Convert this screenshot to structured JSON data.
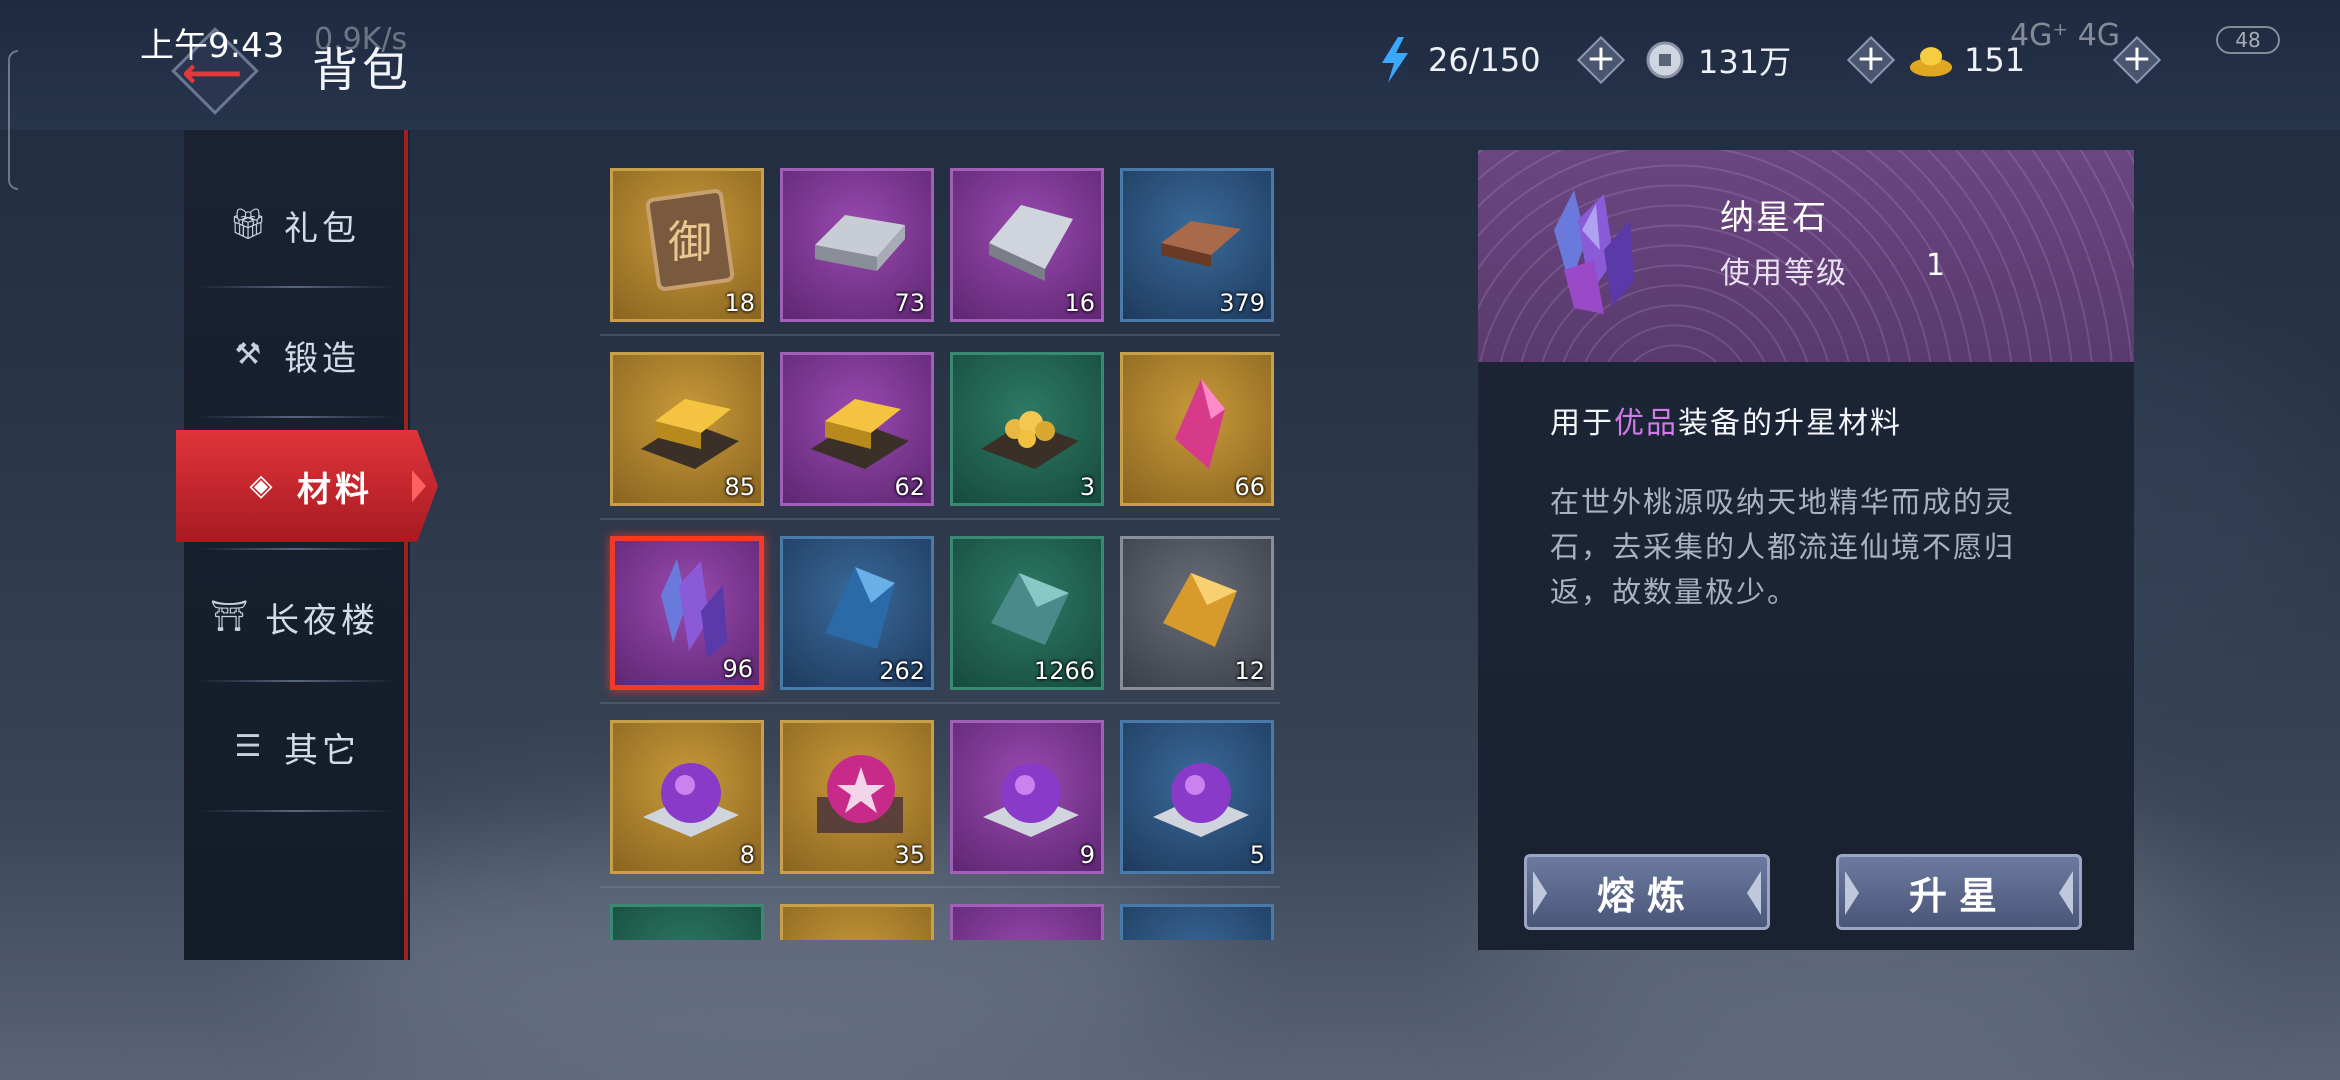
{
  "status_bar": {
    "time": "上午9:43",
    "speed": "0.9K/s",
    "network": "4G⁺ 4G",
    "battery": "48"
  },
  "header": {
    "title": "背包"
  },
  "resources": {
    "stamina": "26/150",
    "coins": "131万",
    "ingots": "151"
  },
  "tabs": [
    {
      "label": "礼包"
    },
    {
      "label": "锻造"
    },
    {
      "label": "材料"
    },
    {
      "label": "长夜楼"
    },
    {
      "label": "其它"
    }
  ],
  "active_tab": "材料",
  "items": [
    {
      "name": "御令",
      "qty": "18",
      "rarity": "gold"
    },
    {
      "name": "银锭",
      "qty": "73",
      "rarity": "purple"
    },
    {
      "name": "玄铁",
      "qty": "16",
      "rarity": "purple"
    },
    {
      "name": "铜锭",
      "qty": "379",
      "rarity": "blue"
    },
    {
      "name": "金锭",
      "qty": "85",
      "rarity": "gold"
    },
    {
      "name": "金锭",
      "qty": "62",
      "rarity": "purple"
    },
    {
      "name": "碎金",
      "qty": "3",
      "rarity": "green"
    },
    {
      "name": "红晶石",
      "qty": "66",
      "rarity": "gold"
    },
    {
      "name": "纳星石",
      "qty": "96",
      "rarity": "purple",
      "selected": true
    },
    {
      "name": "蓝晶石",
      "qty": "262",
      "rarity": "blue"
    },
    {
      "name": "青晶石",
      "qty": "1266",
      "rarity": "green"
    },
    {
      "name": "金晶石",
      "qty": "12",
      "rarity": "gray"
    },
    {
      "name": "紫珠",
      "qty": "8",
      "rarity": "gold"
    },
    {
      "name": "星珠",
      "qty": "35",
      "rarity": "gold"
    },
    {
      "name": "紫珠",
      "qty": "9",
      "rarity": "purple"
    },
    {
      "name": "紫珠",
      "qty": "5",
      "rarity": "blue"
    }
  ],
  "detail": {
    "name": "纳星石",
    "level_label": "使用等级",
    "level_value": "1",
    "usage_pre": "用于",
    "usage_highlight": "优品",
    "usage_post": "装备的升星材料",
    "description": "在世外桃源吸纳天地精华而成的灵石，去采集的人都流连仙境不愿归返，故数量极少。",
    "button_smelt": "熔炼",
    "button_upgrade": "升星"
  },
  "colors": {
    "active_tab": "#d42a30",
    "highlight_text": "#d27ae8",
    "selected_border": "#f03a2a"
  }
}
